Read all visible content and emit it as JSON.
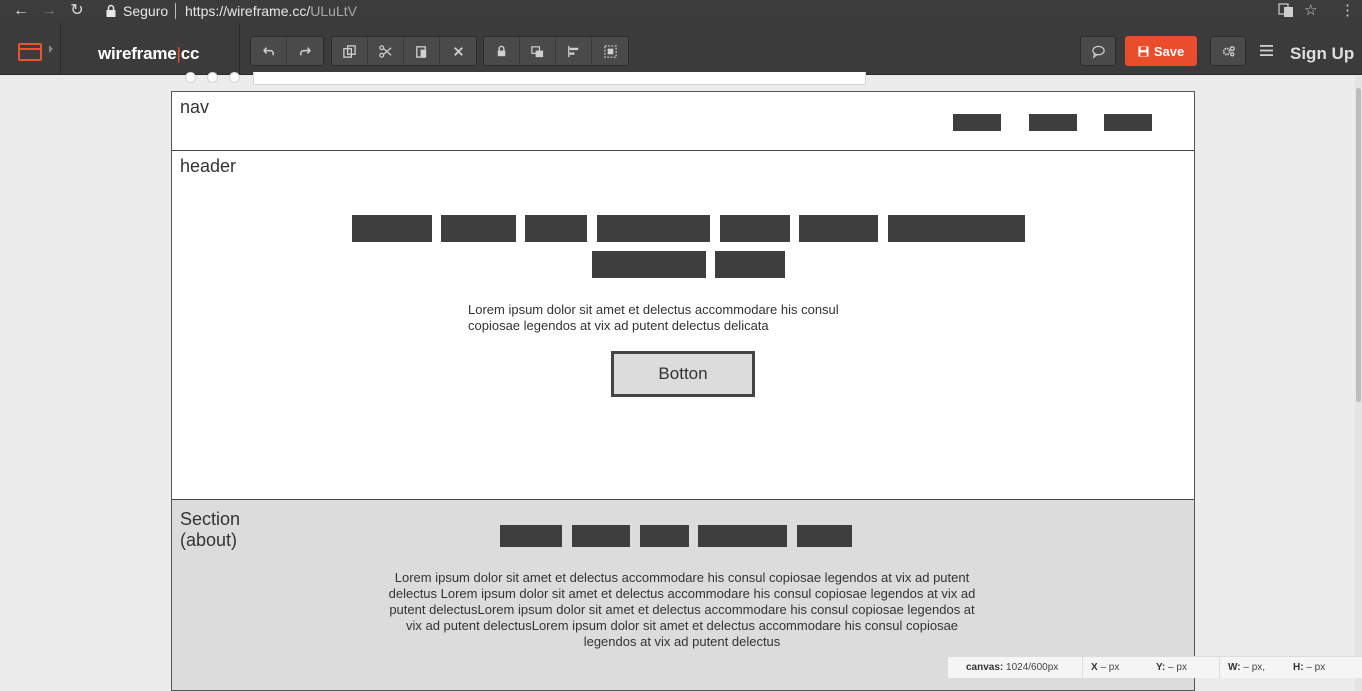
{
  "browser": {
    "secure_label": "Seguro",
    "url_base": "https://wireframe.cc/",
    "url_path": "ULuLtV"
  },
  "toolbar": {
    "logo_main": "wireframe",
    "logo_bar": "|",
    "logo_cc": "cc",
    "save_label": "Save",
    "signup_label": "Sign Up",
    "accent_color": "#ea4d2c",
    "icons": [
      "undo-icon",
      "redo-icon",
      "copy-icon",
      "cut-icon",
      "paste-icon",
      "delete-icon",
      "lock-icon",
      "bring-front-icon",
      "align-icon",
      "group-icon",
      "comment-icon",
      "settings-icon",
      "menu-icon"
    ]
  },
  "canvas": {
    "nav": {
      "label": "nav"
    },
    "header": {
      "label": "header",
      "paragraph": "Lorem ipsum dolor sit amet et delectus accommodare his consul copiosae legendos at vix ad putent delectus delicata",
      "button_label": "Botton"
    },
    "about": {
      "label": "Section\n(about)",
      "paragraph": "Lorem ipsum dolor sit amet et delectus accommodare his consul copiosae legendos at vix ad putent delectus Lorem ipsum dolor sit amet et delectus accommodare his consul copiosae legendos at vix ad putent delectusLorem ipsum dolor sit amet et delectus accommodare his consul copiosae legendos at vix ad putent delectusLorem ipsum dolor sit amet et delectus accommodare his consul copiosae legendos at vix ad putent delectus"
    }
  },
  "status": {
    "canvas_label": "canvas:",
    "canvas_value": "1024/600px",
    "x_label": "X",
    "x_value": "– px",
    "y_label": "Y:",
    "y_value": "– px",
    "w_label": "W:",
    "w_value": "– px,",
    "h_label": "H:",
    "h_value": "– px"
  }
}
